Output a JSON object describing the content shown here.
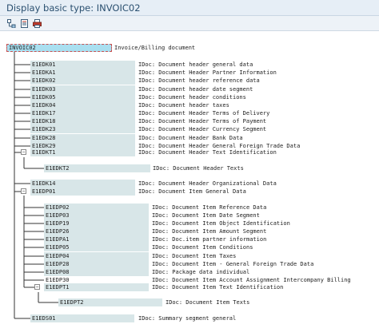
{
  "window": {
    "title": "Display basic type: INVOIC02"
  },
  "toolbar": {
    "icons": [
      "tree-expand-icon",
      "documentation-icon",
      "print-icon"
    ]
  },
  "tree": {
    "root": {
      "label": "INVOIC02",
      "desc": "Invoice/Billing document"
    },
    "segments": [
      {
        "label": "E1EDK01",
        "desc": "IDoc: Document header general data"
      },
      {
        "label": "E1EDKA1",
        "desc": "IDoc: Document Header Partner Information"
      },
      {
        "label": "E1EDK02",
        "desc": "IDoc: Document header reference data"
      },
      {
        "label": "E1EDK03",
        "desc": "IDoc: Document header date segment"
      },
      {
        "label": "E1EDK05",
        "desc": "IDoc: Document header conditions"
      },
      {
        "label": "E1EDK04",
        "desc": "IDoc: Document header taxes"
      },
      {
        "label": "E1EDK17",
        "desc": "IDoc: Document Header Terms of Delivery"
      },
      {
        "label": "E1EDK18",
        "desc": "IDoc: Document Header Terms of Payment"
      },
      {
        "label": "E1EDK23",
        "desc": "IDoc: Document Header Currency Segment"
      },
      {
        "label": "E1EDK28",
        "desc": "IDoc: Document Header Bank Data"
      },
      {
        "label": "E1EDK29",
        "desc": "IDoc: Document Header General Foreign Trade Data"
      },
      {
        "label": "E1EDKT1",
        "desc": "IDoc: Document Header Text Identification"
      },
      {
        "label": "E1EDKT2",
        "desc": "IDoc: Document Header Texts"
      },
      {
        "label": "E1EDK14",
        "desc": "IDoc: Document Header Organizational Data"
      },
      {
        "label": "E1EDP01",
        "desc": "IDoc: Document Item General Data"
      },
      {
        "label": "E1EDP02",
        "desc": "IDoc: Document Item Reference Data"
      },
      {
        "label": "E1EDP03",
        "desc": "IDoc: Document Item Date Segment"
      },
      {
        "label": "E1EDP19",
        "desc": "IDoc: Document Item Object Identification"
      },
      {
        "label": "E1EDP26",
        "desc": "IDoc: Document Item Amount Segment"
      },
      {
        "label": "E1EDPA1",
        "desc": "IDoc: Doc.item partner information"
      },
      {
        "label": "E1EDP05",
        "desc": "IDoc: Document Item Conditions"
      },
      {
        "label": "E1EDP04",
        "desc": "IDoc: Document Item Taxes"
      },
      {
        "label": "E1EDP28",
        "desc": "IDoc: Document Item - General Foreign Trade Data"
      },
      {
        "label": "E1EDP08",
        "desc": "IDoc: Package data individual"
      },
      {
        "label": "E1EDP30",
        "desc": "IDoc: Document Item Account Assignment Intercompany Billing"
      },
      {
        "label": "E1EDPT1",
        "desc": "IDoc: Document Item Text Identification"
      },
      {
        "label": "E1EDPT2",
        "desc": "IDoc: Document Item Texts"
      },
      {
        "label": "E1EDS01",
        "desc": "IDoc: Summary segment general"
      }
    ]
  }
}
